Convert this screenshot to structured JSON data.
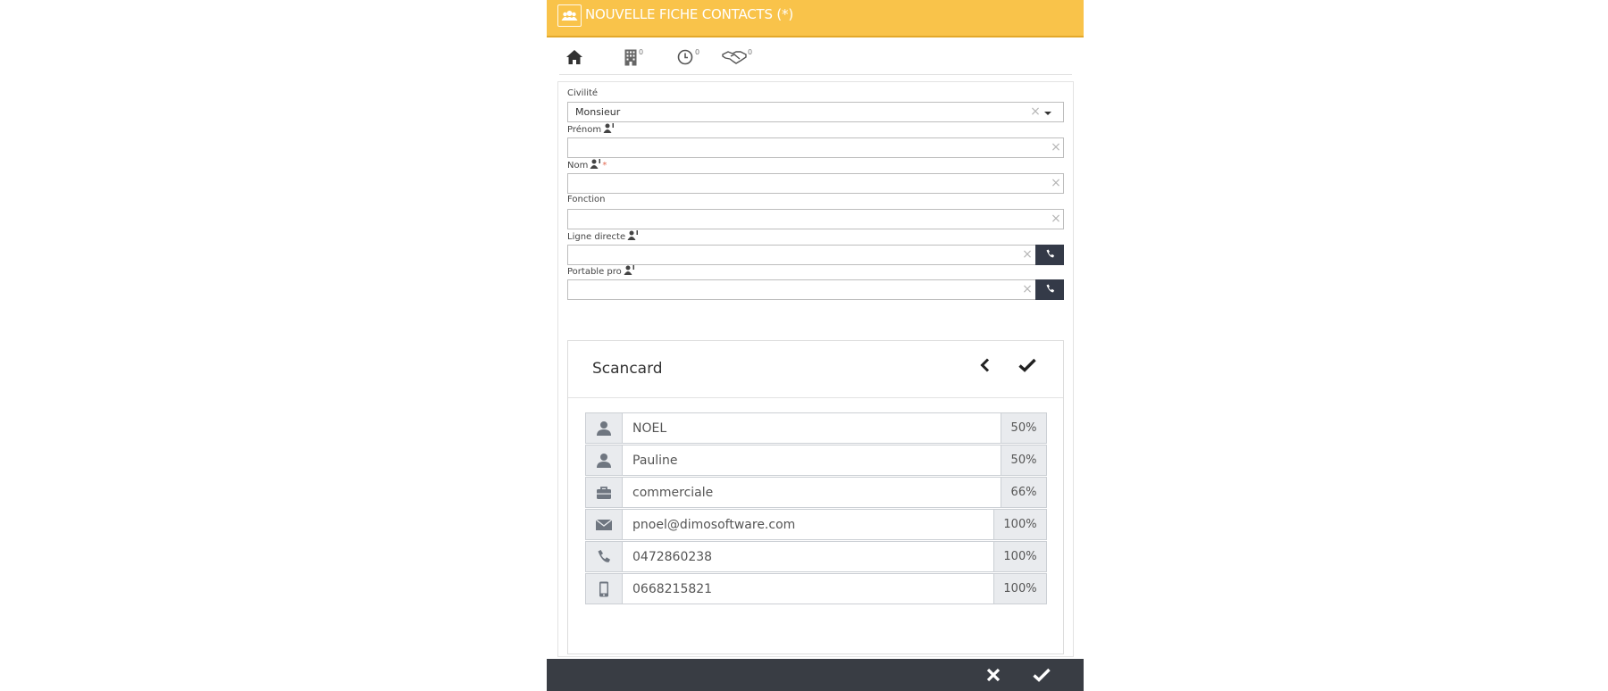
{
  "header": {
    "title": "NOUVELLE FICHE CONTACTS (*)",
    "icon": "users-icon"
  },
  "tabs": [
    {
      "icon": "home-icon",
      "count": ""
    },
    {
      "icon": "building-icon",
      "count": "0"
    },
    {
      "icon": "clock-icon",
      "count": "0"
    },
    {
      "icon": "handshake-icon",
      "count": "0"
    }
  ],
  "form": {
    "civilite": {
      "label": "Civilité",
      "value": "Monsieur"
    },
    "prenom": {
      "label": "Prénom",
      "value": ""
    },
    "nom": {
      "label": "Nom",
      "value": "",
      "required_mark": "*"
    },
    "fonction": {
      "label": "Fonction",
      "value": ""
    },
    "ligne_directe": {
      "label": "Ligne directe",
      "value": ""
    },
    "portable_pro": {
      "label": "Portable pro",
      "value": ""
    },
    "clear_glyph": "×"
  },
  "scancard": {
    "title": "Scancard",
    "rows": [
      {
        "icon": "user-icon",
        "value": "NOEL",
        "confidence": "50%"
      },
      {
        "icon": "user-icon",
        "value": "Pauline",
        "confidence": "50%"
      },
      {
        "icon": "briefcase-icon",
        "value": "commerciale",
        "confidence": "66%"
      },
      {
        "icon": "envelope-icon",
        "value": "pnoel@dimosoftware.com",
        "confidence": "100%"
      },
      {
        "icon": "phone-icon",
        "value": "0472860238",
        "confidence": "100%"
      },
      {
        "icon": "mobile-icon",
        "value": "0668215821",
        "confidence": "100%"
      }
    ]
  },
  "colors": {
    "header": "#f9c34a",
    "footer": "#393d44",
    "phone_button": "#343a48"
  }
}
